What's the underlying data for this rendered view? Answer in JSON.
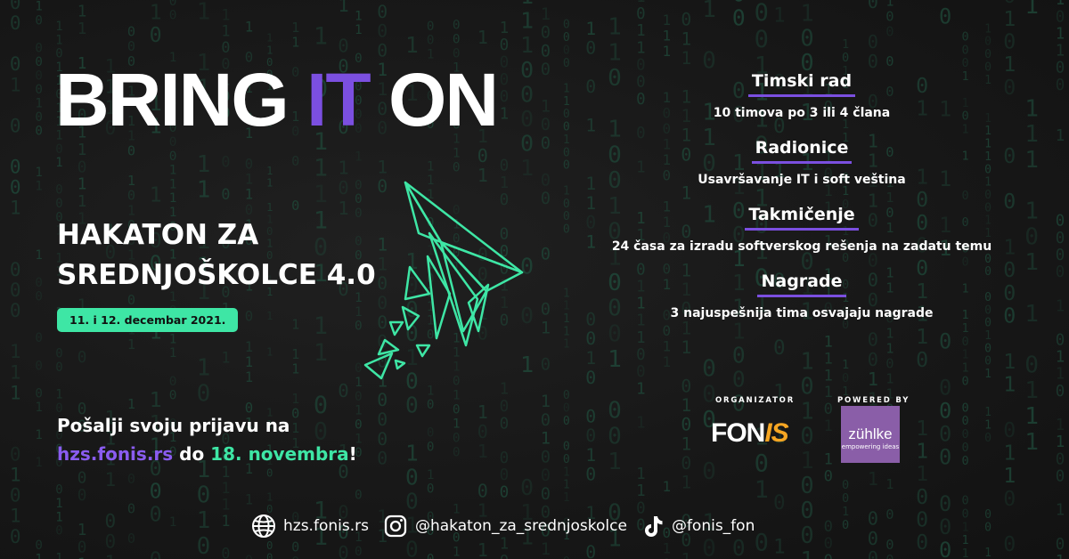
{
  "headline": {
    "part1": "BRING ",
    "highlight": "IT",
    "part2": " ON"
  },
  "subtitle": {
    "line1": "HAKATON ZA",
    "line2": "SREDNJOŠKOLCE 4.0"
  },
  "event_date": "11. i 12. decembar 2021.",
  "features": [
    {
      "title": "Timski rad",
      "description": "10 timova po 3 ili 4 člana"
    },
    {
      "title": "Radionice",
      "description": "Usavršavanje IT i soft veština"
    },
    {
      "title": "Takmičenje",
      "description": "24 časa za izradu softverskog rešenja na zadatu temu"
    },
    {
      "title": "Nagrade",
      "description": "3 najuspešnija tima osvajaju nagrade"
    }
  ],
  "cta": {
    "line1": "Pošalji svoju prijavu na",
    "link": "hzs.fonis.rs",
    "middle": " do ",
    "deadline": "18. novembra",
    "end": "!"
  },
  "sponsors": {
    "organizer_label": "ORGANIZATOR",
    "organizer_logo": {
      "part1": "FON",
      "part2": "IS"
    },
    "powered_label": "POWERED BY",
    "powered_logo": {
      "name": "zühlke",
      "tagline": "empowering ideas"
    }
  },
  "socials": [
    {
      "icon": "globe-icon",
      "text": "hzs.fonis.rs"
    },
    {
      "icon": "instagram-icon",
      "text": "@hakaton_za_srednjoskolce"
    },
    {
      "icon": "tiktok-icon",
      "text": "@fonis_fon"
    }
  ],
  "colors": {
    "accent_purple": "#7b4fe0",
    "accent_green": "#3ee6a5",
    "background": "#171717",
    "fonis_orange": "#f6a623",
    "zuhlke_purple": "#8a5ea8"
  }
}
